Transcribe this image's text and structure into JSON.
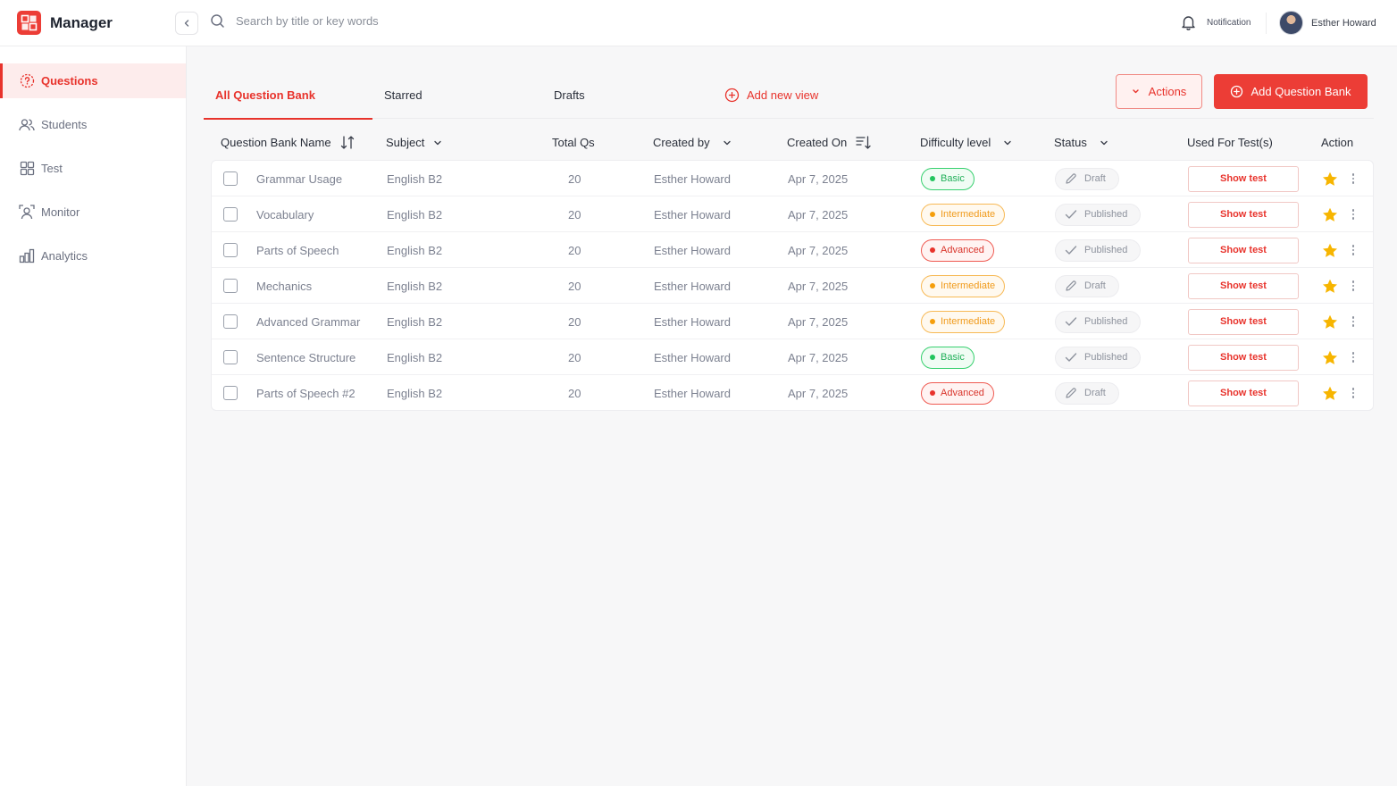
{
  "app": {
    "name": "Manager"
  },
  "search": {
    "placeholder": "Search by title or key words"
  },
  "header": {
    "notification_label": "Notification",
    "user_name": "Esther Howard"
  },
  "sidebar": {
    "items": [
      {
        "label": "Questions",
        "icon": "questions-icon",
        "active": true
      },
      {
        "label": "Students",
        "icon": "students-icon",
        "active": false
      },
      {
        "label": "Test",
        "icon": "test-icon",
        "active": false
      },
      {
        "label": "Monitor",
        "icon": "monitor-icon",
        "active": false
      },
      {
        "label": "Analytics",
        "icon": "analytics-icon",
        "active": false
      }
    ]
  },
  "tabs": [
    {
      "label": "All Question Bank",
      "active": true
    },
    {
      "label": "Starred",
      "active": false
    },
    {
      "label": "Drafts",
      "active": false
    }
  ],
  "toolbar": {
    "add_view_label": "Add new view",
    "actions_label": "Actions",
    "add_bank_label": "Add Question Bank"
  },
  "table": {
    "columns": [
      "Question Bank Name",
      "Subject",
      "Total Qs",
      "Created by",
      "Created On",
      "Difficulty level",
      "Status",
      "Used For Test(s)",
      "Action"
    ],
    "rows": [
      {
        "name": "Grammar Usage",
        "subject": "English B2",
        "total": "20",
        "created_by": "Esther Howard",
        "created_on": "Apr 7, 2025",
        "difficulty": "Basic",
        "status": "Draft",
        "used_for": "Show test",
        "starred": true
      },
      {
        "name": "Vocabulary",
        "subject": "English B2",
        "total": "20",
        "created_by": "Esther Howard",
        "created_on": "Apr 7, 2025",
        "difficulty": "Intermediate",
        "status": "Published",
        "used_for": "Show test",
        "starred": true
      },
      {
        "name": "Parts of Speech",
        "subject": "English B2",
        "total": "20",
        "created_by": "Esther Howard",
        "created_on": "Apr 7, 2025",
        "difficulty": "Advanced",
        "status": "Published",
        "used_for": "Show test",
        "starred": true
      },
      {
        "name": "Mechanics",
        "subject": "English B2",
        "total": "20",
        "created_by": "Esther Howard",
        "created_on": "Apr 7, 2025",
        "difficulty": "Intermediate",
        "status": "Draft",
        "used_for": "Show test",
        "starred": true
      },
      {
        "name": "Advanced Grammar",
        "subject": "English B2",
        "total": "20",
        "created_by": "Esther Howard",
        "created_on": "Apr 7, 2025",
        "difficulty": "Intermediate",
        "status": "Published",
        "used_for": "Show test",
        "starred": true
      },
      {
        "name": "Sentence Structure",
        "subject": "English B2",
        "total": "20",
        "created_by": "Esther Howard",
        "created_on": "Apr 7, 2025",
        "difficulty": "Basic",
        "status": "Published",
        "used_for": "Show test",
        "starred": true
      },
      {
        "name": "Parts of Speech #2",
        "subject": "English B2",
        "total": "20",
        "created_by": "Esther Howard",
        "created_on": "Apr 7, 2025",
        "difficulty": "Advanced",
        "status": "Draft",
        "used_for": "Show test",
        "starred": true
      }
    ]
  },
  "colors": {
    "accent": "#e8332c",
    "basic": "#22c55e",
    "intermediate": "#f59e0b",
    "advanced": "#e8332c",
    "star": "#f7b500"
  }
}
